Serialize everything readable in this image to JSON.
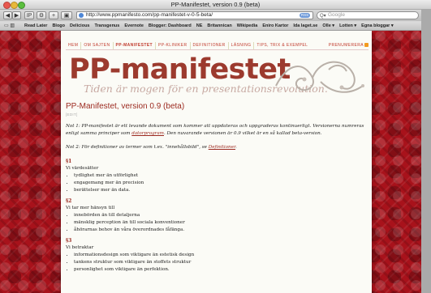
{
  "window": {
    "title": "PP-Manifestet, version 0.9 (beta)"
  },
  "toolbar": {
    "back": "◀",
    "forward": "▶",
    "ip_label": "IP",
    "add_label": "+",
    "url": "http://www.ppmanifesto.com/pp-manifestet-v-0-5-beta/",
    "rss_label": "RSS",
    "search_placeholder": "Google"
  },
  "bookmarks": {
    "items": [
      "Read Later",
      "Blogo",
      "Delicious",
      "Transgenus",
      "Evernote",
      "Blogger: Dashboard",
      "NE",
      "Britannican",
      "Wikipedia",
      "Eniro Kartor",
      "Ida laget.se",
      "Olle ▾",
      "Lotten ▾",
      "Egna bloggar ▾"
    ]
  },
  "site": {
    "nav": [
      "HEM",
      "OM SAJTEN",
      "PP-MANIFESTET",
      "PP-KLINIKER",
      "DEFINITIONER",
      "LÄSNING",
      "TIPS, TRIX & EXEMPEL"
    ],
    "nav_active": 2,
    "subscribe": "PRENUMERERA",
    "logo": "PP-manifestet",
    "tagline": "Tiden är mogen för en presentationsrevolution."
  },
  "post": {
    "title": "PP-Manifestet, version 0.9 (beta)",
    "edit": "[EDIT]",
    "note1_a": "Not 1: PP-manifestet är ett levande dokument som kommer att uppdateras och uppgraderas kontinuerligt. Versionerna numreras enligt samma principer som ",
    "note1_link": "datorprogram",
    "note1_b": ". Den nuvarande versionen är 0.9 vilket är en så kallad beta-version.",
    "note2_a": "Not 2: För definitioner av termer som t.ex. \"innehållsbild\", se ",
    "note2_link": "Definitioner",
    "note2_b": ".",
    "sections": [
      {
        "num": "§1",
        "intro": "Vi värdesätter",
        "items": [
          "tydlighet mer än utförlighet",
          "engagemang mer än precision",
          "berättelser mer än data."
        ]
      },
      {
        "num": "§2",
        "intro": "Vi tar mer hänsyn till",
        "items": [
          "innebörden än till detaljerna",
          "mänsklig perception än till sociala konventioner",
          "åhörarnas behov än våra överordnades fåfänga."
        ]
      },
      {
        "num": "§3",
        "intro": "Vi betraktar",
        "items": [
          "informationsdesign som viktigare än estetisk design",
          "tankens struktur som viktigare än stoffets struktur",
          "personlighet som viktigare än perfektion."
        ]
      }
    ]
  }
}
